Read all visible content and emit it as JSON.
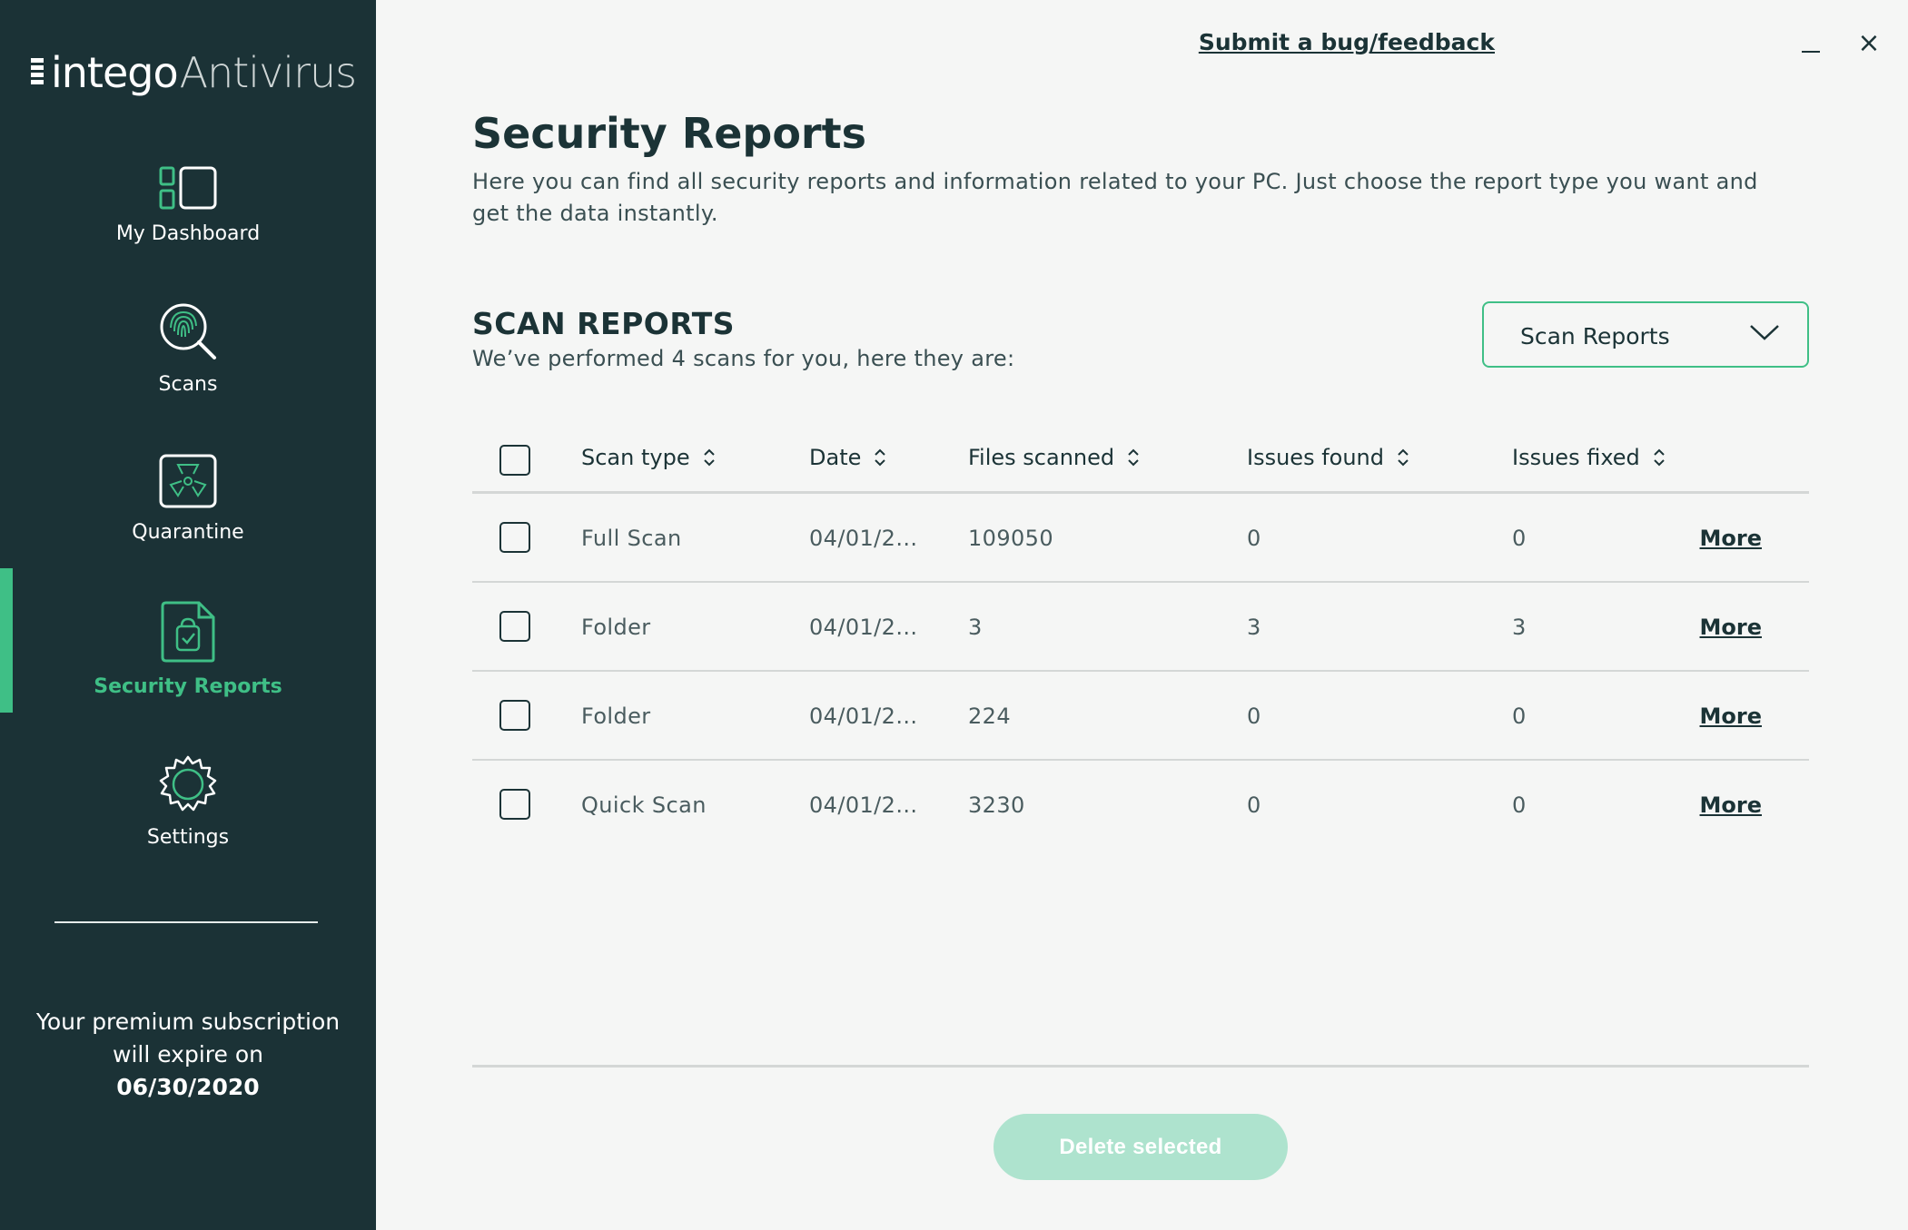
{
  "app": {
    "brand": "intego",
    "product": "Antivirus"
  },
  "sidebar": {
    "items": [
      {
        "label": "My Dashboard",
        "icon": "dashboard-icon"
      },
      {
        "label": "Scans",
        "icon": "fingerprint-search-icon"
      },
      {
        "label": "Quarantine",
        "icon": "radiation-icon"
      },
      {
        "label": "Security Reports",
        "icon": "report-document-icon",
        "active": true
      },
      {
        "label": "Settings",
        "icon": "gear-icon"
      }
    ],
    "subscription": {
      "line1": "Your premium subscription",
      "line2": "will expire on",
      "date": "06/30/2020"
    }
  },
  "topbar": {
    "feedback": "Submit a bug/feedback",
    "minimize": "minimize-icon",
    "close": "close-icon",
    "close_glyph": "×"
  },
  "main": {
    "title": "Security Reports",
    "description": "Here you can find all security reports and information related to your PC. Just choose the report type you want and get the data instantly.",
    "section_title": "SCAN REPORTS",
    "section_sub": "We’ve performed 4 scans for you, here they are:",
    "report_type": {
      "selected": "Scan Reports"
    },
    "table": {
      "columns": [
        "Scan type",
        "Date",
        "Files scanned",
        "Issues found",
        "Issues fixed"
      ],
      "more_label": "More",
      "rows": [
        {
          "type": "Full Scan",
          "date": "04/01/2...",
          "files": "109050",
          "found": "0",
          "fixed": "0"
        },
        {
          "type": "Folder",
          "date": "04/01/2...",
          "files": "3",
          "found": "3",
          "fixed": "3"
        },
        {
          "type": "Folder",
          "date": "04/01/2...",
          "files": "224",
          "found": "0",
          "fixed": "0"
        },
        {
          "type": "Quick Scan",
          "date": "04/01/2...",
          "files": "3230",
          "found": "0",
          "fixed": "0"
        }
      ]
    },
    "delete_button": "Delete selected"
  },
  "colors": {
    "sidebar_bg": "#1b3236",
    "accent": "#3fbf86",
    "text_dark": "#1b3336",
    "delete_disabled": "#aee3ce"
  }
}
